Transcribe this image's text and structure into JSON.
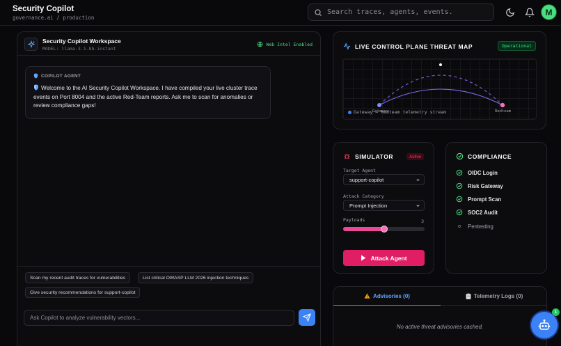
{
  "header": {
    "title": "Security Copilot",
    "subtitle": "governance.ai / production",
    "search_placeholder": "Search traces, agents, events.",
    "avatar_initial": "M"
  },
  "chat": {
    "workspace_title": "Security Copilot Workspace",
    "model": "MODEL: llama-3.1-8b-instant",
    "web_intel": "Web Intel Enabled",
    "message": {
      "sender": "COPILOT AGENT",
      "text": "Welcome to the AI Security Copilot Workspace. I have compiled your live cluster trace events on Port 8004 and the active Red-Team reports. Ask me to scan for anomalies or review compliance gaps!"
    },
    "suggestions": [
      "Scan my recent audit traces for vulnerabilities",
      "List critical OWASP LLM 2026 injection techniques",
      "Give security recommendations for support-copilot"
    ],
    "input_placeholder": "Ask Copilot to analyze vulnerability vectors..."
  },
  "threat_map": {
    "title": "LIVE CONTROL PLANE THREAT MAP",
    "status": "Operational",
    "nodes": {
      "source": "Gateway",
      "target": "Redteam"
    },
    "legend": "Gateway → Redteam telemetry stream"
  },
  "simulator": {
    "title": "SIMULATOR",
    "status": "Active",
    "target_label": "Target Agent",
    "target_value": "support-copilot",
    "category_label": "Attack Category",
    "category_value": "Prompt Injection",
    "payloads_label": "Payloads",
    "payloads_value": "3",
    "payloads_fraction": 0.5,
    "attack_button": "Attack Agent"
  },
  "compliance": {
    "title": "COMPLIANCE",
    "items": [
      {
        "label": "OIDC Login",
        "done": true
      },
      {
        "label": "Risk Gateway",
        "done": true
      },
      {
        "label": "Prompt Scan",
        "done": true
      },
      {
        "label": "SOC2 Audit",
        "done": true
      },
      {
        "label": "Pentesting",
        "done": false
      }
    ]
  },
  "advisories": {
    "tab_advisories": "Advisories (0)",
    "tab_telemetry": "Telemetry Logs (0)",
    "empty_text": "No active threat advisories cached."
  },
  "fab": {
    "badge": "1"
  },
  "colors": {
    "accent": "#3b82f6",
    "success": "#4ade80",
    "danger": "#e11d63",
    "pink": "#ec4899"
  }
}
